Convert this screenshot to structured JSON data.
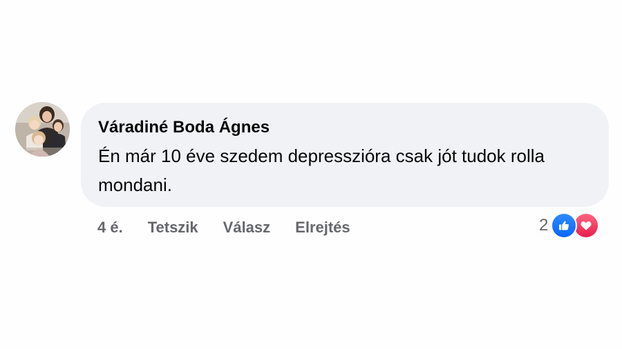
{
  "comment": {
    "author": "Váradiné Boda Ágnes",
    "text": "Én már 10 éve szedem depresszióra csak jót tudok rolla mondani.",
    "avatar_icon": "profile-photo",
    "bubble_color": "#f0f2f5"
  },
  "actions": {
    "time": "4 é.",
    "like_label": "Tetszik",
    "reply_label": "Válasz",
    "hide_label": "Elrejtés"
  },
  "reactions": {
    "count": "2",
    "icons": [
      "like-icon",
      "love-icon"
    ],
    "like_color": "#0866ff",
    "love_color": "#f0284a"
  }
}
